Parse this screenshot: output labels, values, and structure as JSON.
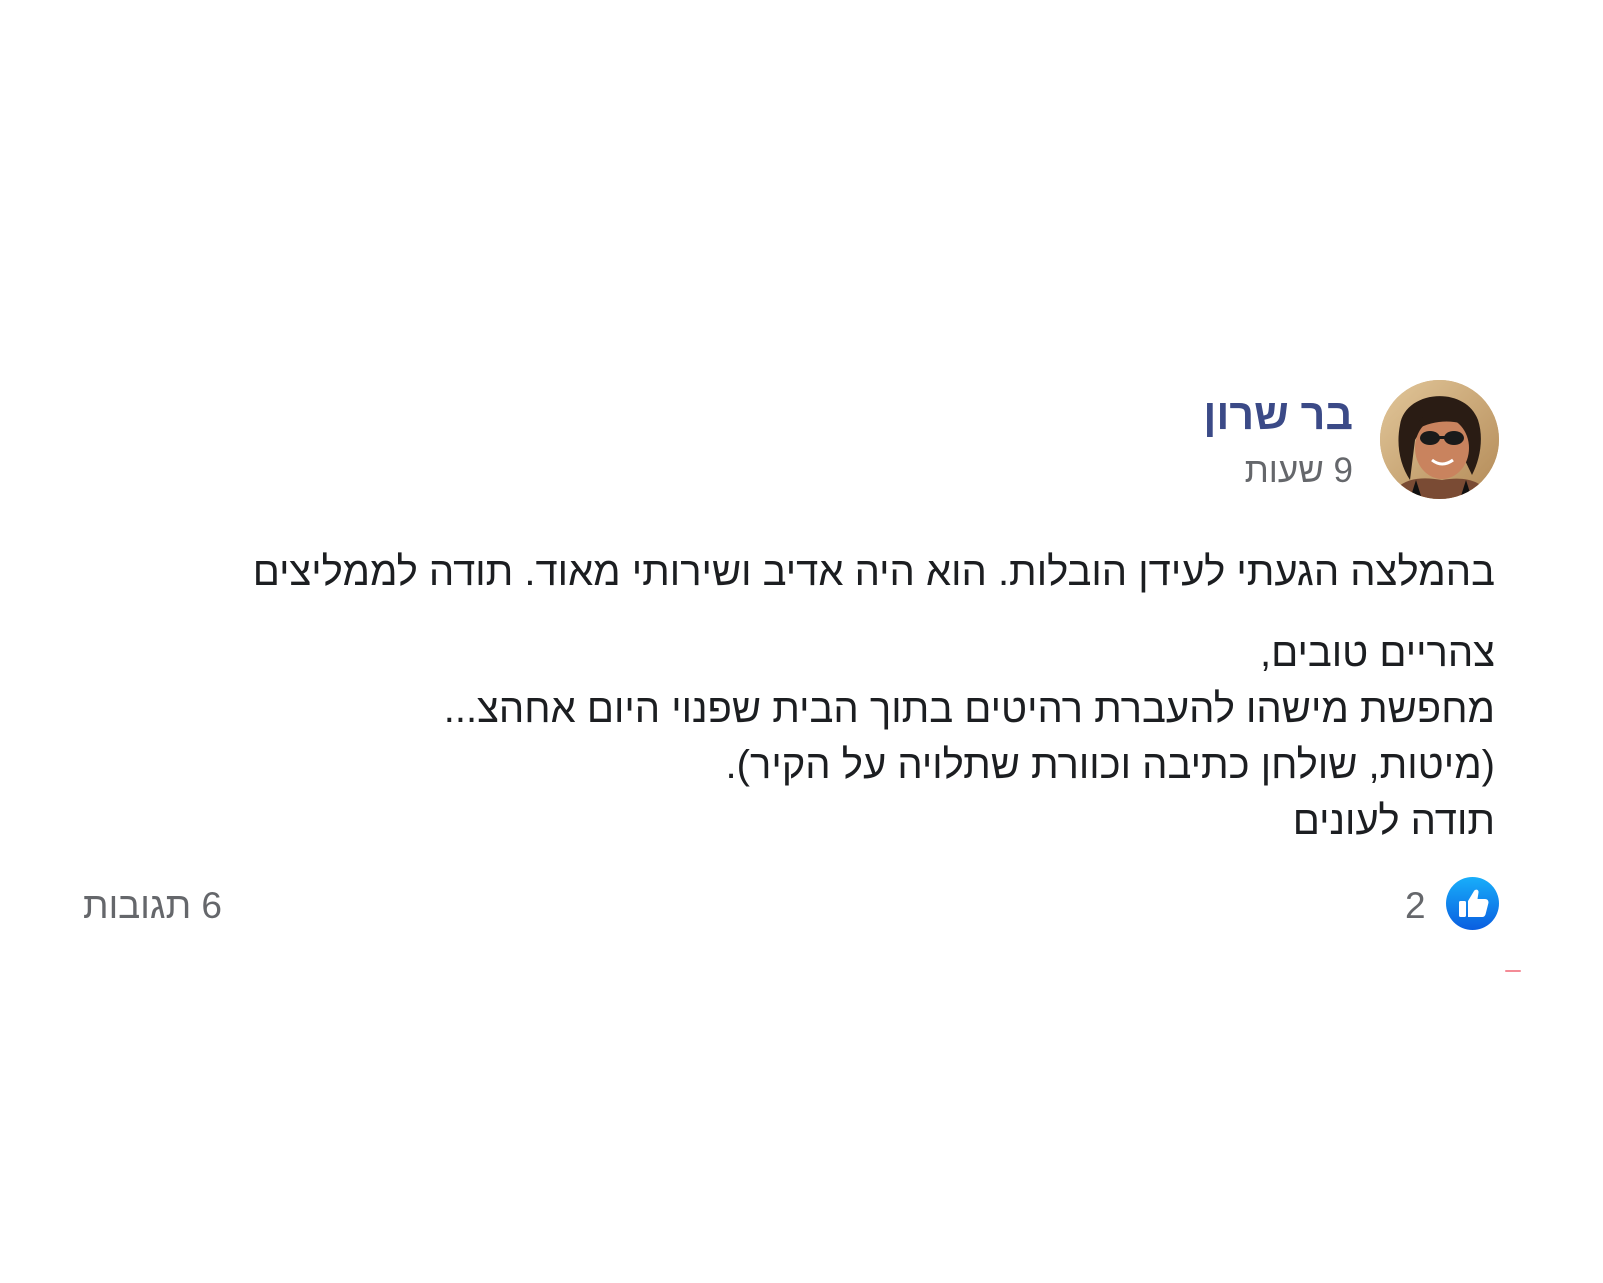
{
  "post": {
    "author_name": "בר שרון",
    "timestamp": "9 שעות",
    "intro_line": "בהמלצה הגעתי לעידן הובלות. הוא היה אדיב ושירותי מאוד. תודה לממליצים",
    "body_lines": [
      "צהריים טובים,",
      "מחפשת מישהו להעברת רהיטים בתוך הבית שפנוי היום אחהצ...",
      "(מיטות, שולחן כתיבה וכוורת שתלויה על הקיר).",
      "תודה לעונים"
    ],
    "avatar_icon": "profile-photo",
    "like_icon": "thumbs-up-icon",
    "like_count": "2",
    "comments_count": "6 תגובות",
    "colors": {
      "author_name": "#3b4a87",
      "secondary_text": "#65676b",
      "like_blue": "#1877f2",
      "text": "#1c1e21"
    }
  }
}
